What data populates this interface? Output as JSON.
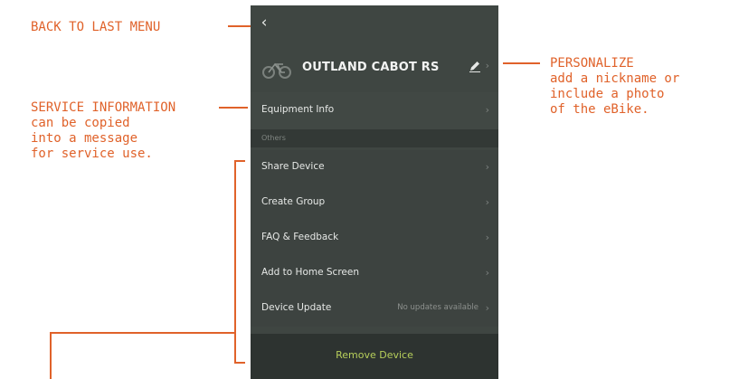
{
  "annotations": {
    "back": "BACK TO LAST MENU",
    "personalize_title": "PERSONALIZE",
    "personalize_desc": "add a nickname or\ninclude a photo\nof the eBike.",
    "service_title": "SERVICE INFORMATION",
    "service_desc": "can be copied\ninto a message\nfor service use."
  },
  "device": {
    "name": "OUTLAND CABOT RS",
    "icon": "bike-icon"
  },
  "menu": {
    "equipment_info": "Equipment Info",
    "section_label": "Others",
    "items": [
      {
        "label": "Share Device"
      },
      {
        "label": "Create Group"
      },
      {
        "label": "FAQ & Feedback"
      },
      {
        "label": "Add to Home Screen"
      },
      {
        "label": "Device Update",
        "value": "No updates available"
      }
    ],
    "remove": "Remove Device"
  },
  "colors": {
    "annotation": "#e0622a",
    "panel": "#3f4642",
    "remove_text": "#b7cf5b"
  }
}
